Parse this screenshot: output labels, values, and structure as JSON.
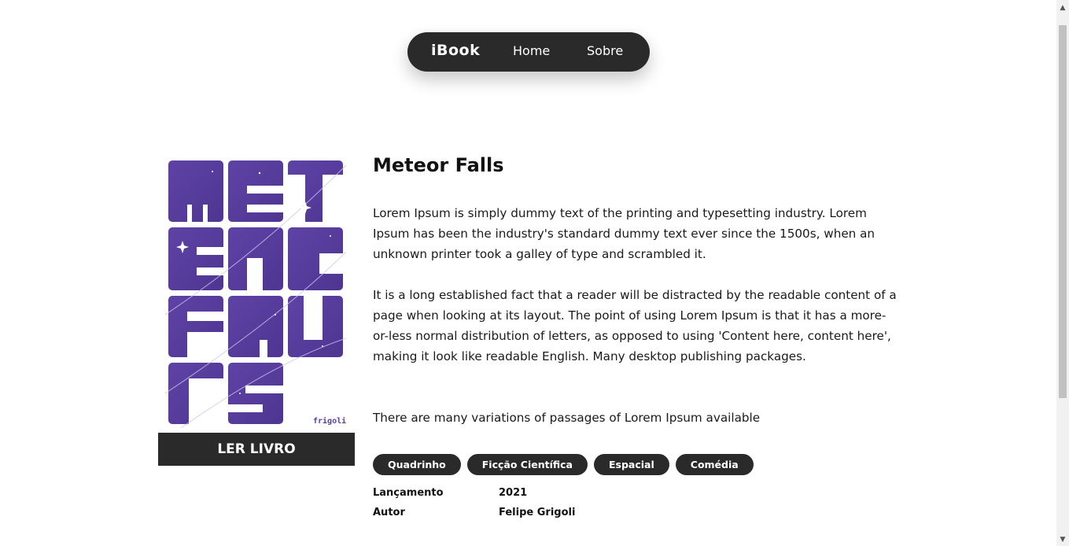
{
  "nav": {
    "brand": "iBook",
    "home_label": "Home",
    "about_label": "Sobre"
  },
  "book": {
    "cover_credit": "frigoli",
    "cover_color": "#5b3fa0",
    "read_button": "LER LIVRO",
    "title": "Meteor Falls",
    "paragraphs": [
      "Lorem Ipsum is simply dummy text of the printing and typesetting industry. Lorem Ipsum has been the industry's standard dummy text ever since the 1500s, when an unknown printer took a galley of type and scrambled it.",
      "It is a long established fact that a reader will be distracted by the readable content of a page when looking at its layout. The point of using Lorem Ipsum is that it has a more-or-less normal distribution of letters, as opposed to using 'Content here, content here', making it look like readable English. Many desktop publishing packages.",
      "There are many variations of passages of Lorem Ipsum available"
    ],
    "tags": [
      "Quadrinho",
      "Ficção Científica",
      "Espacial",
      "Comédia"
    ],
    "meta": {
      "release_label": "Lançamento",
      "release_value": "2021",
      "author_label": "Autor",
      "author_value": "Felipe Grigoli"
    }
  },
  "colors": {
    "dark": "#2a2a2a",
    "background": "#ffffff"
  }
}
